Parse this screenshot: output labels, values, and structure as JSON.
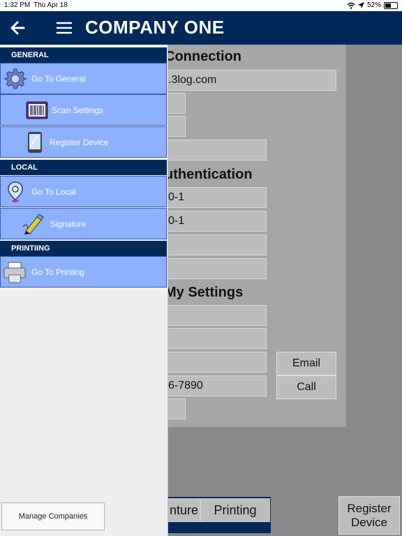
{
  "status_bar": {
    "time": "1:32 PM",
    "date": "Thu Apr 18",
    "battery": "52%",
    "battery_level": 0.52
  },
  "header": {
    "title": "COMPANY ONE"
  },
  "background": {
    "connection_title": "Connection",
    "server_value": ".3log.com",
    "auth_title": "uthentication",
    "auth_value1": "0-1",
    "auth_value2": "0-1",
    "settings_title": "My Settings",
    "phone_value": "6-7890",
    "email_label": "Email",
    "call_label": "Call",
    "tab_signature": "nture",
    "tab_printing": "Printing",
    "register_label_line1": "Register",
    "register_label_line2": "Device"
  },
  "drawer": {
    "groups": [
      {
        "label": "GENERAL"
      },
      {
        "label": "LOCAL"
      },
      {
        "label": "PRINTIING"
      }
    ],
    "items": [
      {
        "label": "Go To General",
        "icon": "gear-icon"
      },
      {
        "label": "Scan Settings",
        "icon": "barcode-scanner-icon"
      },
      {
        "label": "Register Device",
        "icon": "tablet-icon"
      },
      {
        "label": "Go To Local",
        "icon": "location-pin-icon"
      },
      {
        "label": "Signature",
        "icon": "pen-icon"
      },
      {
        "label": "Go To Printing",
        "icon": "printer-icon"
      }
    ],
    "manage_label": "Manage Companies"
  }
}
